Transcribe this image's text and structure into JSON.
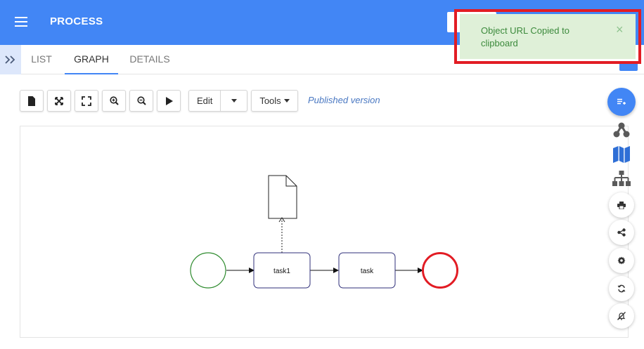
{
  "header": {
    "title": "PROCESS",
    "menu_icon": "hamburger-icon",
    "color": "#4286f5"
  },
  "tabs": [
    {
      "label": "LIST",
      "active": false
    },
    {
      "label": "GRAPH",
      "active": true
    },
    {
      "label": "DETAILS",
      "active": false
    }
  ],
  "toolbar": {
    "buttons": [
      "new-document-icon",
      "fit-icon",
      "fullscreen-icon",
      "zoom-in-icon",
      "zoom-out-icon",
      "play-icon"
    ],
    "edit_label": "Edit",
    "tools_label": "Tools",
    "status": "Published version"
  },
  "diagram": {
    "tasks": [
      "task1",
      "task"
    ],
    "start_color": "#2e8b2e",
    "end_color": "#e21c24",
    "task_border": "#2f2f7a"
  },
  "rail": {
    "buttons": [
      "list-add-icon",
      "network-icon",
      "map-icon",
      "hierarchy-icon",
      "print-icon",
      "share-icon",
      "gear-icon",
      "sync-icon",
      "notifications-off-icon"
    ]
  },
  "toast": {
    "message": "Object URL Copied to clipboard",
    "close_symbol": "×"
  }
}
